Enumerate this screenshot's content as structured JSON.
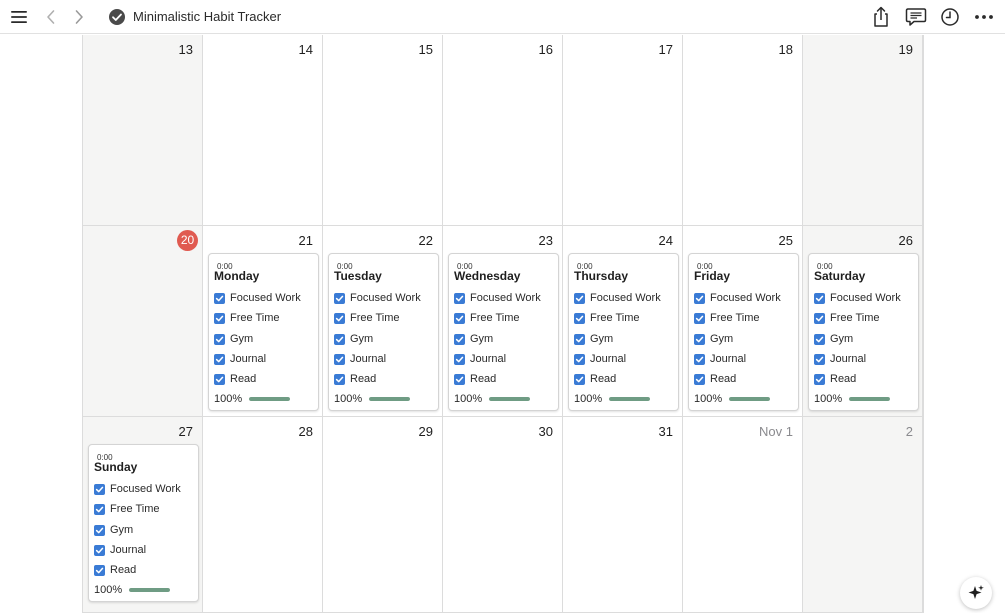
{
  "toolbar": {
    "title": "Minimalistic Habit Tracker",
    "icons": [
      "sidebar-menu-icon",
      "back-chevron-icon",
      "forward-chevron-icon",
      "checkmark-circle-icon",
      "share-icon",
      "comments-icon",
      "history-clock-icon",
      "more-ellipsis-icon"
    ]
  },
  "colors": {
    "checkbox": "#3a7bd5",
    "progress": "#6f9c84",
    "today": "#e05a50",
    "weekend_cell": "#f5f5f4"
  },
  "calendar": {
    "weeks": [
      {
        "days": [
          {
            "label": "13",
            "weekend": true
          },
          {
            "label": "14"
          },
          {
            "label": "15"
          },
          {
            "label": "16"
          },
          {
            "label": "17"
          },
          {
            "label": "18"
          },
          {
            "label": "19",
            "weekend": true
          }
        ]
      },
      {
        "days": [
          {
            "label": "20",
            "weekend": true,
            "today": true
          },
          {
            "label": "21",
            "card": 0
          },
          {
            "label": "22",
            "card": 1
          },
          {
            "label": "23",
            "card": 2
          },
          {
            "label": "24",
            "card": 3
          },
          {
            "label": "25",
            "card": 4
          },
          {
            "label": "26",
            "weekend": true,
            "card": 5
          }
        ]
      },
      {
        "days": [
          {
            "label": "27",
            "weekend": true,
            "card": 6
          },
          {
            "label": "28"
          },
          {
            "label": "29"
          },
          {
            "label": "30"
          },
          {
            "label": "31"
          },
          {
            "label": "Nov 1",
            "muted": true
          },
          {
            "label": "2",
            "weekend": true,
            "muted": true
          }
        ]
      }
    ]
  },
  "cards": [
    {
      "time": "0:00",
      "title": "Monday",
      "habits": [
        "Focused Work",
        "Free Time",
        "Gym",
        "Journal",
        "Read"
      ],
      "checked": [
        true,
        true,
        true,
        true,
        true
      ],
      "percent_label": "100%",
      "progress": 1.0
    },
    {
      "time": "0:00",
      "title": "Tuesday",
      "habits": [
        "Focused Work",
        "Free Time",
        "Gym",
        "Journal",
        "Read"
      ],
      "checked": [
        true,
        true,
        true,
        true,
        true
      ],
      "percent_label": "100%",
      "progress": 1.0
    },
    {
      "time": "0:00",
      "title": "Wednesday",
      "habits": [
        "Focused Work",
        "Free Time",
        "Gym",
        "Journal",
        "Read"
      ],
      "checked": [
        true,
        true,
        true,
        true,
        true
      ],
      "percent_label": "100%",
      "progress": 1.0
    },
    {
      "time": "0:00",
      "title": "Thursday",
      "habits": [
        "Focused Work",
        "Free Time",
        "Gym",
        "Journal",
        "Read"
      ],
      "checked": [
        true,
        true,
        true,
        true,
        true
      ],
      "percent_label": "100%",
      "progress": 1.0
    },
    {
      "time": "0:00",
      "title": "Friday",
      "habits": [
        "Focused Work",
        "Free Time",
        "Gym",
        "Journal",
        "Read"
      ],
      "checked": [
        true,
        true,
        true,
        true,
        true
      ],
      "percent_label": "100%",
      "progress": 1.0
    },
    {
      "time": "0:00",
      "title": "Saturday",
      "habits": [
        "Focused Work",
        "Free Time",
        "Gym",
        "Journal",
        "Read"
      ],
      "checked": [
        true,
        true,
        true,
        true,
        true
      ],
      "percent_label": "100%",
      "progress": 1.0
    },
    {
      "time": "0:00",
      "title": "Sunday",
      "habits": [
        "Focused Work",
        "Free Time",
        "Gym",
        "Journal",
        "Read"
      ],
      "checked": [
        true,
        true,
        true,
        true,
        true
      ],
      "percent_label": "100%",
      "progress": 1.0
    }
  ],
  "fab": {
    "icon": "ai-sparkle-icon"
  }
}
